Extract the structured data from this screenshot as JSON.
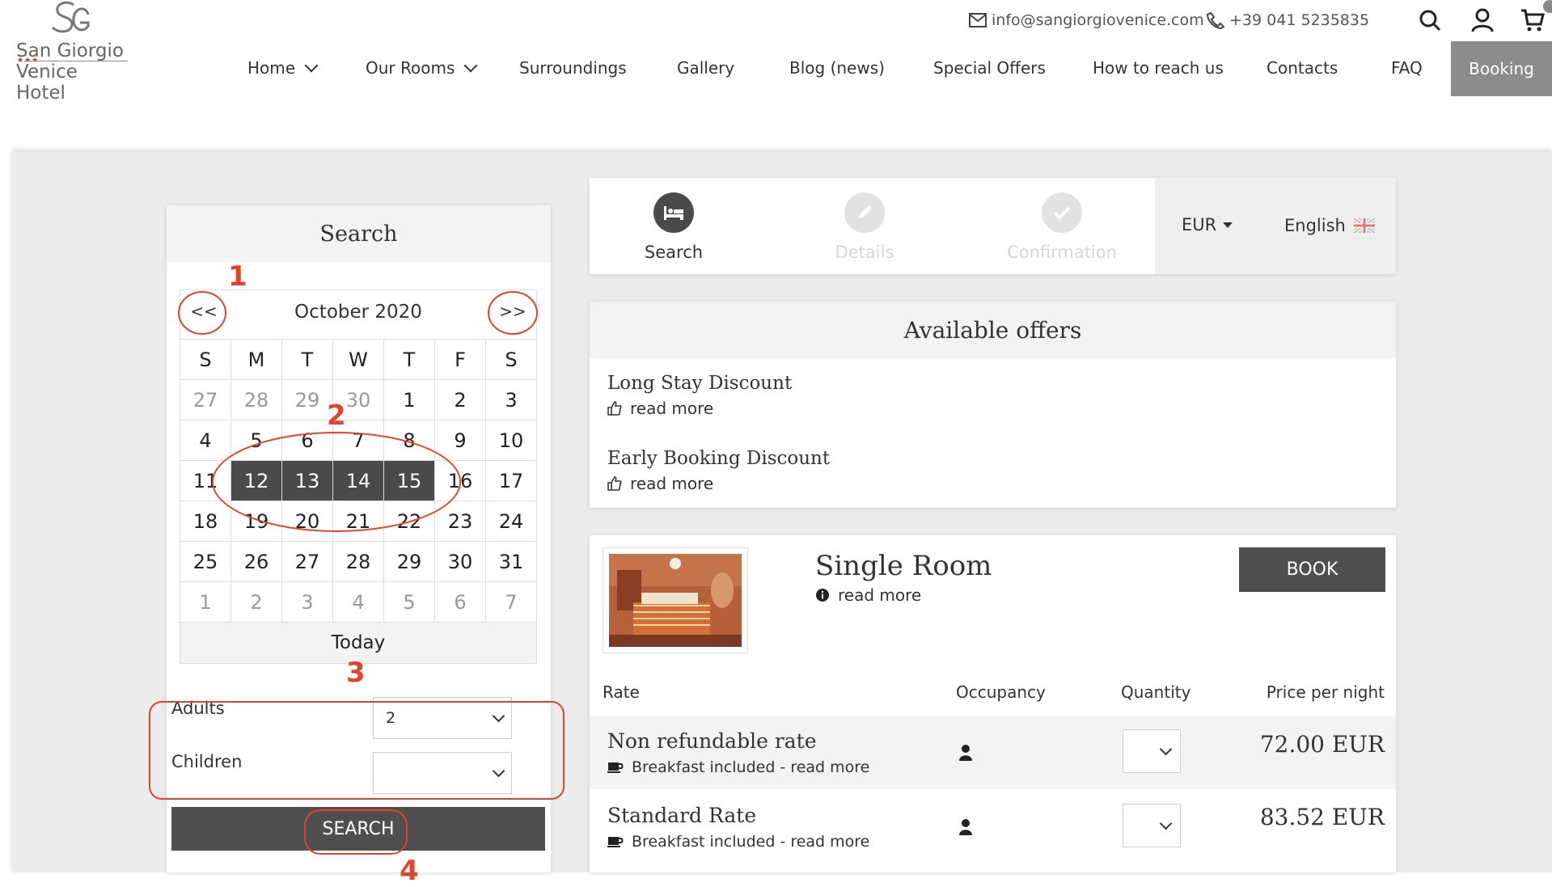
{
  "header": {
    "logo_line1": "San Giorgio",
    "logo_stars": "★★★",
    "logo_line2": "Venice Hotel",
    "email": "info@sangiorgiovenice.com",
    "phone": "+39 041 5235835",
    "icons": [
      "search-icon",
      "user-icon",
      "cart-icon"
    ]
  },
  "nav": {
    "items": [
      {
        "label": "Home",
        "dropdown": true
      },
      {
        "label": "Our Rooms",
        "dropdown": true
      },
      {
        "label": "Surroundings"
      },
      {
        "label": "Gallery"
      },
      {
        "label": "Blog (news)"
      },
      {
        "label": "Special Offers"
      },
      {
        "label": "How to reach us"
      },
      {
        "label": "Contacts"
      },
      {
        "label": "FAQ"
      }
    ],
    "booking": "Booking"
  },
  "search_panel": {
    "title": "Search",
    "calendar": {
      "prev": "<<",
      "next": ">>",
      "month": "October 2020",
      "weekdays": [
        "S",
        "M",
        "T",
        "W",
        "T",
        "F",
        "S"
      ],
      "weeks": [
        [
          "27",
          "28",
          "29",
          "30",
          "1",
          "2",
          "3"
        ],
        [
          "4",
          "5",
          "6",
          "7",
          "8",
          "9",
          "10"
        ],
        [
          "11",
          "12",
          "13",
          "14",
          "15",
          "16",
          "17"
        ],
        [
          "18",
          "19",
          "20",
          "21",
          "22",
          "23",
          "24"
        ],
        [
          "25",
          "26",
          "27",
          "28",
          "29",
          "30",
          "31"
        ],
        [
          "1",
          "2",
          "3",
          "4",
          "5",
          "6",
          "7"
        ]
      ],
      "selected_days": [
        "12",
        "13",
        "14",
        "15"
      ],
      "today": "Today"
    },
    "adults_label": "Adults",
    "adults_value": "2",
    "children_label": "Children",
    "children_value": "",
    "search_button": "SEARCH"
  },
  "annotations": [
    "1",
    "2",
    "3",
    "4"
  ],
  "steps": {
    "items": [
      {
        "label": "Search",
        "active": true,
        "icon": "bed-icon"
      },
      {
        "label": "Details",
        "active": false,
        "icon": "pencil-icon"
      },
      {
        "label": "Confirmation",
        "active": false,
        "icon": "check-icon"
      }
    ],
    "currency": "EUR",
    "language": "English"
  },
  "offers": {
    "title": "Available offers",
    "items": [
      {
        "title": "Long Stay Discount",
        "link": "read more"
      },
      {
        "title": "Early Booking Discount",
        "link": "read more"
      }
    ]
  },
  "room": {
    "title": "Single Room",
    "read_more": "read more",
    "book_button": "BOOK",
    "columns": {
      "rate": "Rate",
      "occupancy": "Occupancy",
      "quantity": "Quantity",
      "price": "Price per night"
    },
    "rates": [
      {
        "name": "Non refundable rate",
        "sub": "Breakfast included - read more",
        "price": "72.00 EUR"
      },
      {
        "name": "Standard Rate",
        "sub": "Breakfast included - read more",
        "price": "83.52 EUR"
      }
    ]
  },
  "colors": {
    "annotation": "#e0442d",
    "dark_button": "#4f4f4f",
    "booking_button": "#8c8c8c"
  }
}
